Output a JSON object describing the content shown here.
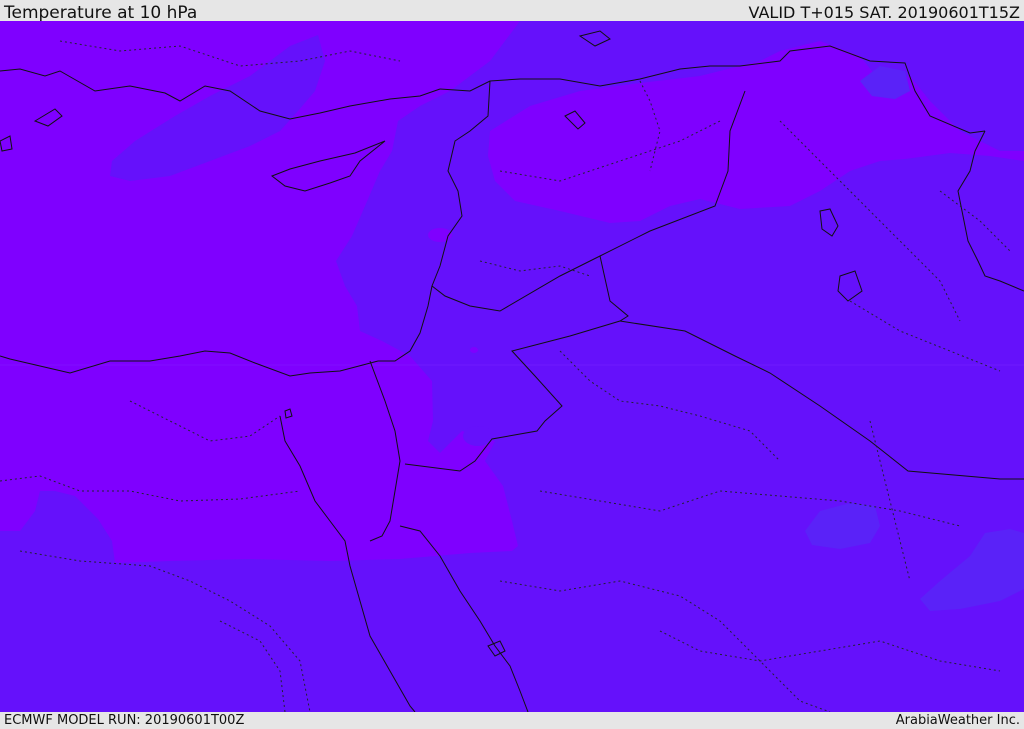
{
  "header": {
    "title": "Temperature at 10 hPa",
    "valid_time": "VALID T+015 SAT. 20190601T15Z"
  },
  "footer": {
    "model_run": "ECMWF MODEL RUN: 20190601T00Z",
    "credit": "ArabiaWeather Inc."
  },
  "map": {
    "colors": {
      "warm_band": "#7f00ff",
      "cool_band": "#6511fb",
      "coolest_band": "#5a22f8",
      "boundary": "#111111"
    }
  }
}
